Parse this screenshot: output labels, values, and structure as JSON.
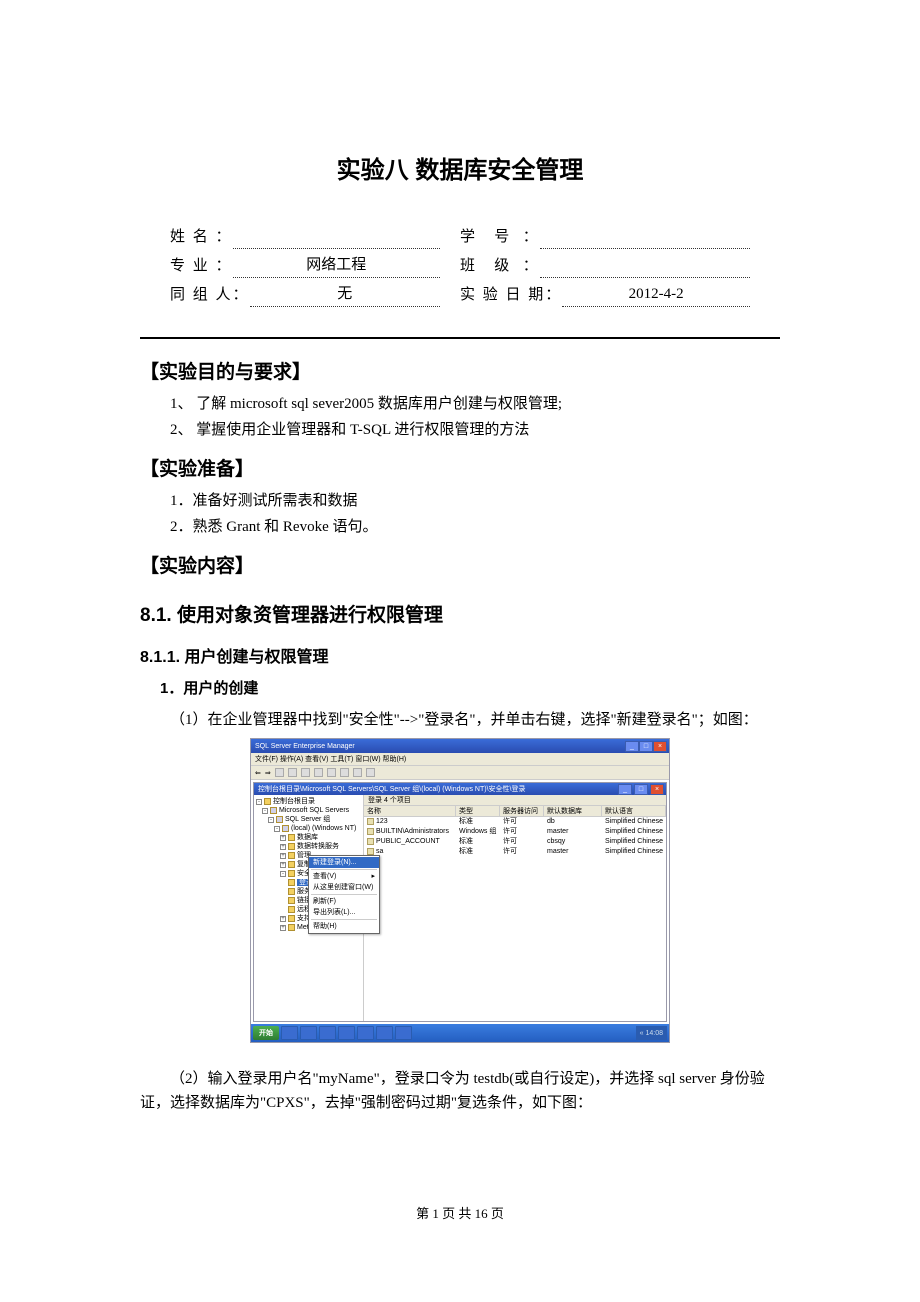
{
  "title": "实验八   数据库安全管理",
  "info": {
    "name_label": "姓 名 ：",
    "name_value": "",
    "id_label": "学   号  ：",
    "id_value": "",
    "major_label": "专 业 ：",
    "major_value": "网络工程",
    "class_label": "班   级  ：",
    "class_value": "",
    "group_label": "同 组 人：",
    "group_value": "无",
    "date_label": "实 验 日 期：",
    "date_value": "2012-4-2"
  },
  "sections": {
    "goal_header": "【实验目的与要求】",
    "goal_1": "1、 了解 microsoft sql sever2005 数据库用户创建与权限管理;",
    "goal_2": "2、 掌握使用企业管理器和 T-SQL 进行权限管理的方法",
    "prep_header": "【实验准备】",
    "prep_1": "1．准备好测试所需表和数据",
    "prep_2": "2．熟悉 Grant 和 Revoke 语句。",
    "content_header": "【实验内容】",
    "h2": "8.1. 使用对象资管理器进行权限管理",
    "h3": "8.1.1. 用户创建与权限管理",
    "h4": "1．用户的创建",
    "p1": "（1）在企业管理器中找到\"安全性\"-->\"登录名\"，并单击右键，选择\"新建登录名\"；如图：",
    "p2": "（2）输入登录用户名\"myName\"，登录口令为 testdb(或自行设定)，并选择 sql server 身份验证，选择数据库为\"CPXS\"，去掉\"强制密码过期\"复选条件，如下图："
  },
  "screenshot": {
    "titlebar": "SQL Server Enterprise Manager",
    "menubar": "文件(F)  操作(A)  查看(V)  工具(T)  窗口(W)  帮助(H)",
    "inner_title": "控制台根目录\\Microsoft SQL Servers\\SQL Server 组\\(local) (Windows NT)\\安全性\\登录",
    "list_top": "登录   4 个项目",
    "tree": {
      "root": "控制台根目录",
      "n1": "Microsoft SQL Servers",
      "n2": "SQL Server 组",
      "n3": "(local) (Windows NT)",
      "n4a": "数据库",
      "n4b": "数据转换服务",
      "n4c": "管理",
      "n4d": "复制",
      "n4e": "安全性",
      "n5a": "登录",
      "n5b": "服务器角色",
      "n5c": "链接服务器",
      "n5d": "远程服务器",
      "n4f": "支持服务",
      "n4g": "Meta Data Services"
    },
    "context_menu": {
      "m1": "新建登录(N)...",
      "m2": "查看(V)",
      "m3": "从这里创建窗口(W)",
      "m4": "刷新(F)",
      "m5": "导出列表(L)...",
      "m6": "帮助(H)"
    },
    "columns": {
      "c1": "名称",
      "c2": "类型",
      "c3": "服务器访问",
      "c4": "默认数据库",
      "c5": "默认语言"
    },
    "rows": [
      {
        "name": "123",
        "type": "标准",
        "access": "许可",
        "db": "db",
        "lang": "Simplified Chinese"
      },
      {
        "name": "BUILTIN\\Administrators",
        "type": "Windows 组",
        "access": "许可",
        "db": "master",
        "lang": "Simplified Chinese"
      },
      {
        "name": "PUBLIC_ACCOUNT",
        "type": "标准",
        "access": "许可",
        "db": "cbsqy",
        "lang": "Simplified Chinese"
      },
      {
        "name": "sa",
        "type": "标准",
        "access": "许可",
        "db": "master",
        "lang": "Simplified Chinese"
      }
    ],
    "taskbar": {
      "start": "开始",
      "tasks": [
        "",
        "",
        "",
        "",
        "",
        "",
        ""
      ],
      "tray": "« 14:08"
    }
  },
  "footer": "第 1 页 共 16 页"
}
